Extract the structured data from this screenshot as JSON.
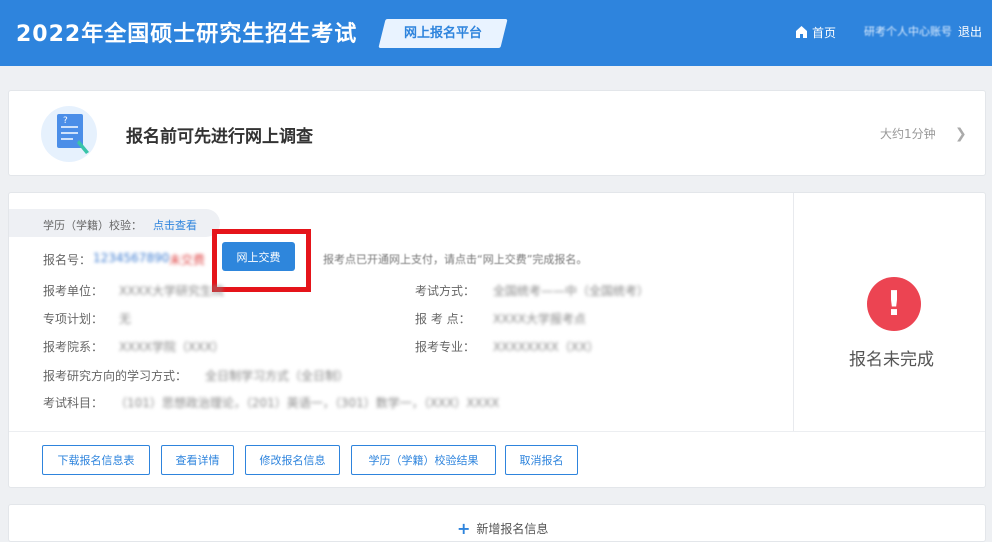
{
  "header": {
    "site_title": "2022年全国硕士研究生招生考试",
    "platform_badge": "网上报名平台",
    "nav": {
      "home": "首页",
      "account": "研考个人中心账号",
      "logout": "退出"
    }
  },
  "survey": {
    "title": "报名前可先进行网上调查",
    "time_note": "大约1分钟"
  },
  "registration": {
    "education_check_label": "学历（学籍）校验：",
    "education_check_link": "点击查看",
    "reg_no_label": "报名号：",
    "reg_no_value": "1234567890",
    "unpaid_tag": "未交费",
    "pay_button": "网上交费",
    "pay_notice": "报考点已开通网上支付，请点击“网上交费”完成报名。",
    "fields_left": [
      {
        "label": "报考单位：",
        "value": "XXXX大学研究生院"
      },
      {
        "label": "专项计划：",
        "value": "无"
      },
      {
        "label": "报考院系：",
        "value": "XXXX学院（XXX）"
      }
    ],
    "fields_right": [
      {
        "label": "考试方式：",
        "value": "全国统考——中（全国统考）"
      },
      {
        "label": "报 考 点：",
        "value": "XXXX大学报考点"
      },
      {
        "label": "报考专业：",
        "value": "XXXXXXXX（XX）"
      }
    ],
    "direction_label": "报考研究方向的学习方式：",
    "direction_value": "全日制学习方式（全日制）",
    "exam_subjects_label": "考试科目：",
    "exam_subjects_value": "（101）思想政治理论，（201）英语一，（301）数学一，（XXX）XXXX",
    "status": "报名未完成",
    "actions": [
      "下载报名信息表",
      "查看详情",
      "修改报名信息",
      "学历（学籍）校验结果",
      "取消报名"
    ]
  },
  "add_new": {
    "label": "新增报名信息"
  },
  "colors": {
    "primary": "#2e84dd",
    "highlight": "#e5141a",
    "status_error": "#ec4452"
  },
  "icons": [
    "home-icon",
    "document-icon",
    "chevron-right-icon",
    "exclamation-icon",
    "plus-icon"
  ]
}
